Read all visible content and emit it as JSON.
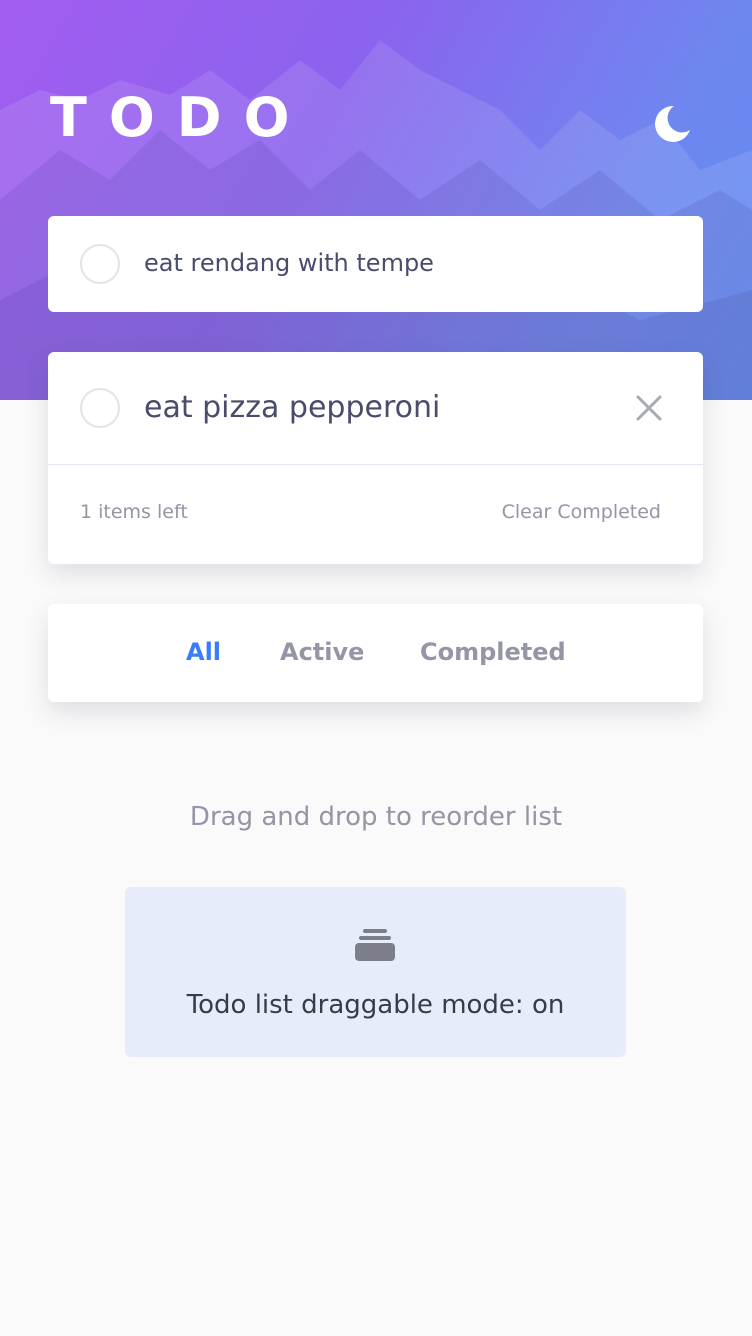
{
  "header": {
    "title": "TODO",
    "theme_icon": "moon-icon"
  },
  "todos": [
    {
      "text": "eat rendang with tempe",
      "completed": false
    },
    {
      "text": "eat pizza pepperoni",
      "completed": false
    }
  ],
  "list_footer": {
    "items_left": "1 items left",
    "clear_label": "Clear Completed"
  },
  "filters": {
    "all": "All",
    "active": "Active",
    "completed": "Completed",
    "selected": "All"
  },
  "hint": "Drag and drop to reorder list",
  "drag_mode": {
    "icon": "layers-icon",
    "label": "Todo list draggable mode: on"
  },
  "colors": {
    "accent": "#3a7cfd",
    "hero_start": "#a25df0",
    "hero_end": "#5f8ef2",
    "text": "#494c6b",
    "muted": "#9495a5"
  }
}
